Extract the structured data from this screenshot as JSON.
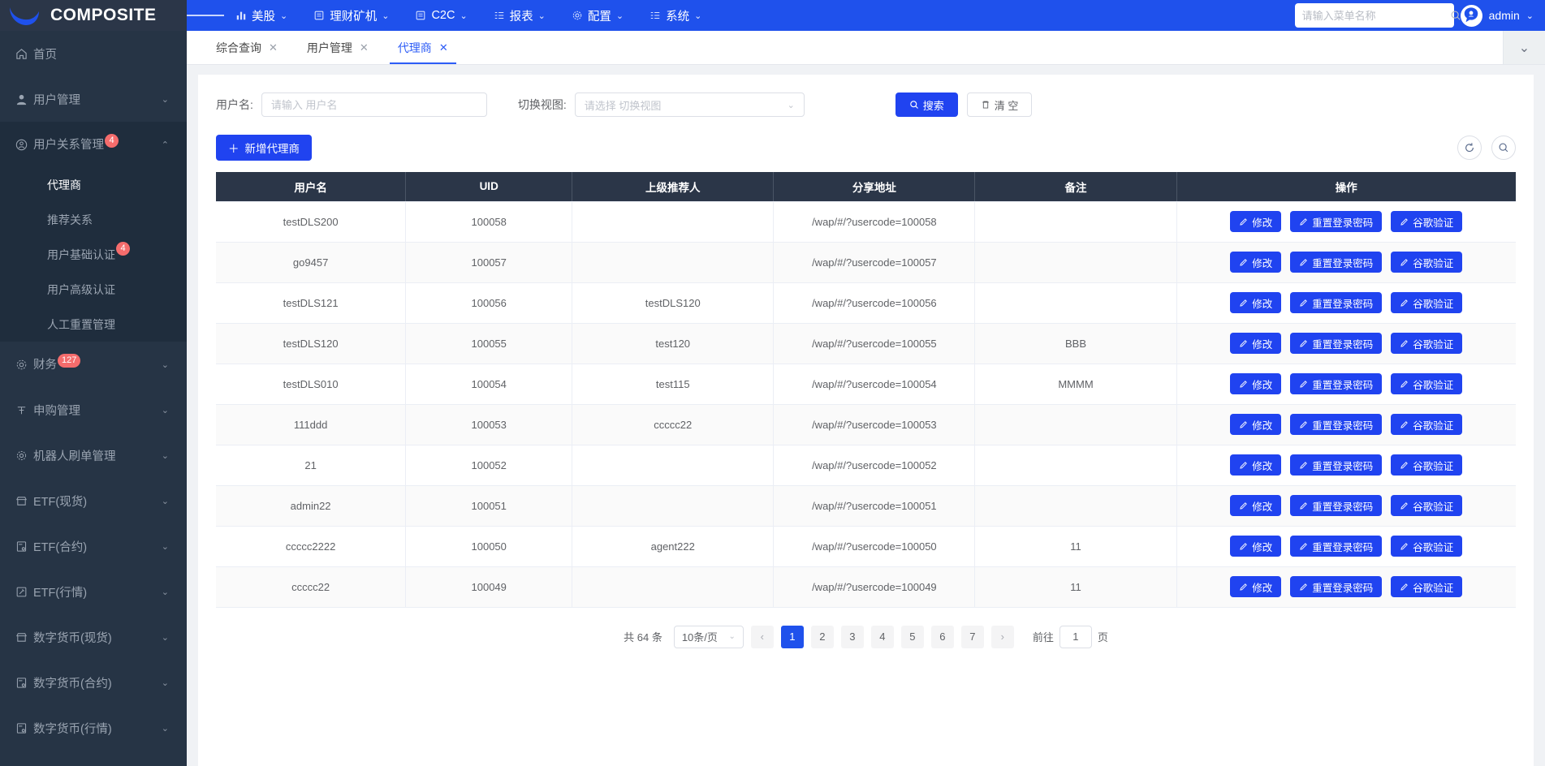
{
  "brand": {
    "name": "COMPOSITE",
    "logo_icon": "crescent-logo-icon"
  },
  "topnav": {
    "hamburger_icon": "hamburger-icon",
    "items": [
      {
        "label": "美股",
        "icon": "chart-bar-icon"
      },
      {
        "label": "理财矿机",
        "icon": "list-icon"
      },
      {
        "label": "C2C",
        "icon": "document-icon"
      },
      {
        "label": "报表",
        "icon": "report-icon"
      },
      {
        "label": "配置",
        "icon": "gear-icon"
      },
      {
        "label": "系统",
        "icon": "system-icon"
      }
    ],
    "caret": "⌄",
    "menu_search": {
      "placeholder": "请输入菜单名称",
      "value": "",
      "icon": "search-icon"
    },
    "user": {
      "name": "admin",
      "avatar_icon": "user-avatar-icon",
      "caret": "⌄"
    }
  },
  "sidebar": {
    "items": [
      {
        "label": "首页",
        "icon": "home-icon",
        "type": "link",
        "badge": "",
        "arrow": ""
      },
      {
        "label": "用户管理",
        "icon": "user-icon",
        "type": "group",
        "badge": "",
        "arrow": "⌄"
      },
      {
        "label": "用户关系管理",
        "icon": "user-circle-icon",
        "type": "group",
        "badge": "4",
        "arrow": "⌃",
        "open": true
      },
      {
        "label": "财务",
        "icon": "gear-icon",
        "type": "group",
        "badge": "127",
        "arrow": "⌄"
      },
      {
        "label": "申购管理",
        "icon": "subscribe-icon",
        "type": "group",
        "badge": "",
        "arrow": "⌄"
      },
      {
        "label": "机器人刷单管理",
        "icon": "robot-gear-icon",
        "type": "group",
        "badge": "",
        "arrow": "⌄"
      },
      {
        "label": "ETF(现货)",
        "icon": "shop-icon",
        "type": "group",
        "badge": "",
        "arrow": "⌄"
      },
      {
        "label": "ETF(合约)",
        "icon": "sql-icon",
        "type": "group",
        "badge": "",
        "arrow": "⌄"
      },
      {
        "label": "ETF(行情)",
        "icon": "edit-square-icon",
        "type": "group",
        "badge": "",
        "arrow": "⌄"
      },
      {
        "label": "数字货币(现货)",
        "icon": "shop-icon",
        "type": "group",
        "badge": "",
        "arrow": "⌄"
      },
      {
        "label": "数字货币(合约)",
        "icon": "sql-icon",
        "type": "group",
        "badge": "",
        "arrow": "⌄"
      },
      {
        "label": "数字货币(行情)",
        "icon": "sql-icon",
        "type": "group",
        "badge": "",
        "arrow": "⌄"
      }
    ],
    "submenu": [
      {
        "label": "代理商",
        "active": true,
        "badge": ""
      },
      {
        "label": "推荐关系",
        "active": false,
        "badge": ""
      },
      {
        "label": "用户基础认证",
        "active": false,
        "badge": "4"
      },
      {
        "label": "用户高级认证",
        "active": false,
        "badge": ""
      },
      {
        "label": "人工重置管理",
        "active": false,
        "badge": ""
      }
    ]
  },
  "tabbar": {
    "tabs": [
      {
        "label": "综合查询",
        "active": false,
        "close": "✕"
      },
      {
        "label": "用户管理",
        "active": false,
        "close": "✕"
      },
      {
        "label": "代理商",
        "active": true,
        "close": "✕"
      }
    ],
    "collapse_caret": "⌄"
  },
  "search_form": {
    "username_label": "用户名:",
    "username_placeholder": "请输入 用户名",
    "username_value": "",
    "view_label": "切换视图:",
    "view_placeholder": "请选择 切换视图",
    "view_value": "",
    "search_button": "搜索",
    "search_icon": "search-icon",
    "clear_button": "清 空",
    "clear_icon": "trash-icon"
  },
  "toolbar": {
    "add_button": "新增代理商",
    "add_icon": "plus-icon",
    "refresh_icon": "refresh-icon",
    "zoom_icon": "search-circle-icon"
  },
  "table": {
    "columns": [
      "用户名",
      "UID",
      "上级推荐人",
      "分享地址",
      "备注",
      "操作"
    ],
    "rows": [
      {
        "username": "testDLS200",
        "uid": "100058",
        "referrer": "",
        "share": "/wap/#/?usercode=100058",
        "remark": ""
      },
      {
        "username": "go9457",
        "uid": "100057",
        "referrer": "",
        "share": "/wap/#/?usercode=100057",
        "remark": ""
      },
      {
        "username": "testDLS121",
        "uid": "100056",
        "referrer": "testDLS120",
        "share": "/wap/#/?usercode=100056",
        "remark": ""
      },
      {
        "username": "testDLS120",
        "uid": "100055",
        "referrer": "test120",
        "share": "/wap/#/?usercode=100055",
        "remark": "BBB"
      },
      {
        "username": "testDLS010",
        "uid": "100054",
        "referrer": "test115",
        "share": "/wap/#/?usercode=100054",
        "remark": "MMMM"
      },
      {
        "username": "111ddd",
        "uid": "100053",
        "referrer": "ccccc22",
        "share": "/wap/#/?usercode=100053",
        "remark": ""
      },
      {
        "username": "21",
        "uid": "100052",
        "referrer": "",
        "share": "/wap/#/?usercode=100052",
        "remark": ""
      },
      {
        "username": "admin22",
        "uid": "100051",
        "referrer": "",
        "share": "/wap/#/?usercode=100051",
        "remark": ""
      },
      {
        "username": "ccccc2222",
        "uid": "100050",
        "referrer": "agent222",
        "share": "/wap/#/?usercode=100050",
        "remark": "11"
      },
      {
        "username": "ccccc22",
        "uid": "100049",
        "referrer": "",
        "share": "/wap/#/?usercode=100049",
        "remark": "11"
      }
    ],
    "op_buttons": [
      {
        "label": "修改",
        "icon": "pencil-icon"
      },
      {
        "label": "重置登录密码",
        "icon": "pencil-icon"
      },
      {
        "label": "谷歌验证",
        "icon": "pencil-icon"
      }
    ]
  },
  "pagination": {
    "total_text": "共 64 条",
    "page_size": "10条/页",
    "page_size_caret": "⌄",
    "prev": "‹",
    "next": "›",
    "pages": [
      "1",
      "2",
      "3",
      "4",
      "5",
      "6",
      "7"
    ],
    "current_page": "1",
    "jump_prefix": "前往",
    "jump_value": "1",
    "jump_suffix": "页"
  },
  "colors": {
    "brand_blue": "#1f51ec",
    "button_blue": "#2043f0",
    "sidebar_bg": "#263445",
    "sidebar_active_bg": "#1f2d3d",
    "table_head_bg": "#2b3648",
    "badge_red": "#f56c6c"
  }
}
